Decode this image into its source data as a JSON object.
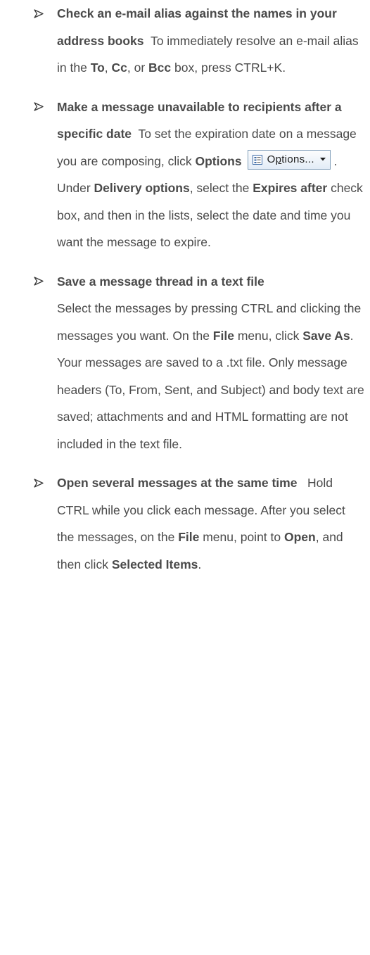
{
  "tips": [
    {
      "title": "Check an e-mail alias against the names in your address books",
      "t1": "To immediately resolve an e-mail alias in the ",
      "b1": "To",
      "t2": ", ",
      "b2": "Cc",
      "t3": ", or ",
      "b3": "Bcc",
      "t4": " box, press CTRL+K."
    },
    {
      "title": "Make a message unavailable to recipients after a specific date",
      "t1": "To set the expiration date on a message you are composing, click ",
      "b1": "Options",
      "button": {
        "label_prefix": "O",
        "label_underline": "p",
        "label_suffix": "tions...",
        "icon": "options-icon",
        "dropdown_icon": "dropdown-arrow-icon"
      },
      "t2": ". Under ",
      "b2": "Delivery options",
      "t3": ", select the ",
      "b3": "Expires after",
      "t4": " check box, and then in the lists, select the date and time you want the message to expire."
    },
    {
      "title": "Save a message thread in a text file",
      "t1": "Select the messages by pressing CTRL and clicking the messages you want. On the ",
      "b1": "File",
      "t2": " menu, click ",
      "b2": "Save As",
      "t3": ". Your messages are saved to a .txt file. Only message headers (To, From, Sent, and Subject) and body text are saved; attachments and and HTML formatting are not included in the text file."
    },
    {
      "title": "Open several messages at the same time",
      "t1": "Hold CTRL while you click each message. After you select the messages, on the ",
      "b1": "File",
      "t2": " menu, point to ",
      "b2": "Open",
      "t3": ", and then click ",
      "b3": "Selected Items",
      "t4": "."
    }
  ],
  "colors": {
    "text": "#4a4a4a",
    "bullet": "#3a3a3a",
    "button_border": "#7f9db9"
  },
  "bullet_icon": "arrow-bullet-icon"
}
